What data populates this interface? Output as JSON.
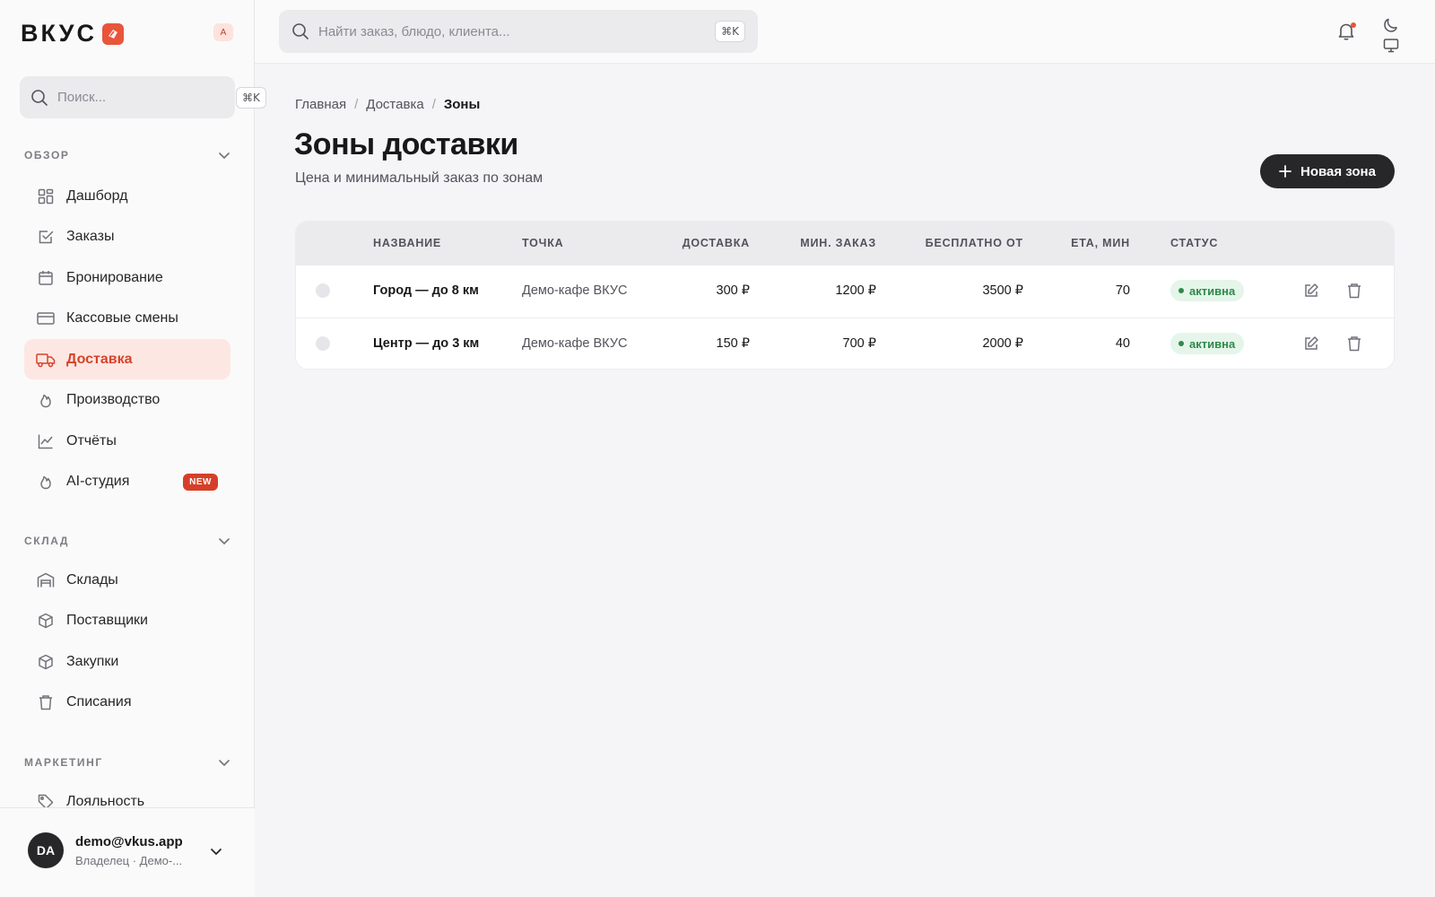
{
  "brand": {
    "name": "ВКУС",
    "lang_badge": "A"
  },
  "sidebar": {
    "search_placeholder": "Поиск...",
    "search_kbd": "⌘K",
    "sections": [
      {
        "title": "ОБЗОР"
      },
      {
        "title": "СКЛАД"
      },
      {
        "title": "МАРКЕТИНГ"
      }
    ],
    "overview_items": [
      {
        "label": "Дашборд",
        "icon": "grid-icon"
      },
      {
        "label": "Заказы",
        "icon": "check-square-icon"
      },
      {
        "label": "Бронирование",
        "icon": "calendar-icon"
      },
      {
        "label": "Кассовые смены",
        "icon": "card-icon"
      },
      {
        "label": "Доставка",
        "icon": "truck-icon",
        "active": true
      },
      {
        "label": "Производство",
        "icon": "flame-icon"
      },
      {
        "label": "Отчёты",
        "icon": "chart-line-icon"
      },
      {
        "label": "AI-студия",
        "icon": "flame-icon",
        "badge": "NEW"
      }
    ],
    "warehouse_items": [
      {
        "label": "Склады",
        "icon": "warehouse-icon"
      },
      {
        "label": "Поставщики",
        "icon": "box-icon"
      },
      {
        "label": "Закупки",
        "icon": "box-icon"
      },
      {
        "label": "Списания",
        "icon": "trash-icon"
      }
    ],
    "marketing_items": [
      {
        "label": "Лояльность",
        "icon": "tag-icon"
      }
    ]
  },
  "user": {
    "initials": "DA",
    "email": "demo@vkus.app",
    "role": "Владелец · Демо-..."
  },
  "topbar": {
    "search_placeholder": "Найти заказ, блюдо, клиента...",
    "search_kbd": "⌘K"
  },
  "breadcrumb": {
    "home": "Главная",
    "section": "Доставка",
    "current": "Зоны"
  },
  "page": {
    "title": "Зоны доставки",
    "subtitle": "Цена и минимальный заказ по зонам",
    "new_button": "Новая зона"
  },
  "table": {
    "columns": {
      "name": "НАЗВАНИЕ",
      "point": "ТОЧКА",
      "delivery": "ДОСТАВКА",
      "min_order": "МИН. ЗАКАЗ",
      "free_from": "БЕСПЛАТНО ОТ",
      "eta": "ETA, МИН",
      "status": "СТАТУС"
    },
    "rows": [
      {
        "name": "Город — до 8 км",
        "point": "Демо-кафе ВКУС",
        "delivery": "300 ₽",
        "min_order": "1200 ₽",
        "free_from": "3500 ₽",
        "eta": "70",
        "status": "активна"
      },
      {
        "name": "Центр — до 3 км",
        "point": "Демо-кафе ВКУС",
        "delivery": "150 ₽",
        "min_order": "700 ₽",
        "free_from": "2000 ₽",
        "eta": "40",
        "status": "активна"
      }
    ]
  },
  "colors": {
    "accent": "#d6432c",
    "active_bg": "#fde7e2",
    "status_green": "#2f8a4b",
    "dark_button": "#27272a"
  }
}
